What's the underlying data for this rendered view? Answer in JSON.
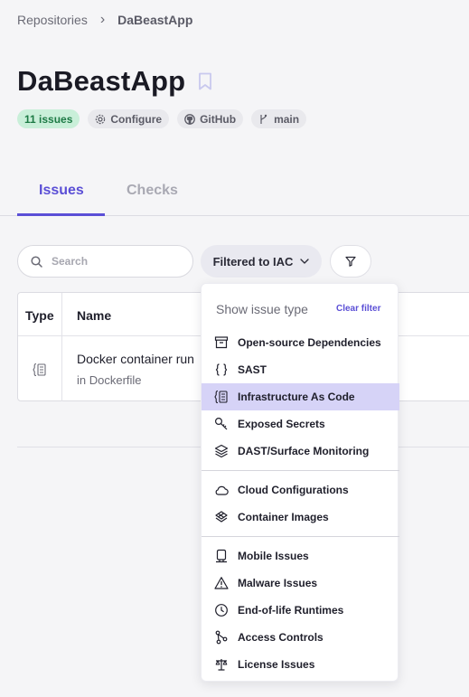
{
  "breadcrumb": {
    "root": "Repositories",
    "current": "DaBeastApp"
  },
  "page": {
    "title": "DaBeastApp"
  },
  "chips": {
    "issues": "11 issues",
    "configure": "Configure",
    "github": "GitHub",
    "branch": "main"
  },
  "tabs": {
    "issues": "Issues",
    "checks": "Checks"
  },
  "search": {
    "placeholder": "Search",
    "value": ""
  },
  "filter": {
    "label": "Filtered to IAC"
  },
  "table": {
    "headers": {
      "type": "Type",
      "name": "Name"
    },
    "rows": [
      {
        "name": "Docker container run",
        "location": "in Dockerfile"
      }
    ]
  },
  "dropdown": {
    "heading": "Show issue type",
    "clear": "Clear filter",
    "items": [
      {
        "label": "Open-source Dependencies",
        "icon": "package-icon"
      },
      {
        "label": "SAST",
        "icon": "braces-icon"
      },
      {
        "label": "Infrastructure As Code",
        "icon": "iac-icon",
        "selected": true
      },
      {
        "label": "Exposed Secrets",
        "icon": "key-icon"
      },
      {
        "label": "DAST/Surface Monitoring",
        "icon": "layers-icon"
      },
      {
        "label": "Cloud Configurations",
        "icon": "cloud-icon"
      },
      {
        "label": "Container Images",
        "icon": "container-icon"
      },
      {
        "label": "Mobile Issues",
        "icon": "mobile-icon"
      },
      {
        "label": "Malware Issues",
        "icon": "warning-icon"
      },
      {
        "label": "End-of-life Runtimes",
        "icon": "clock-icon"
      },
      {
        "label": "Access Controls",
        "icon": "branch-nodes-icon"
      },
      {
        "label": "License Issues",
        "icon": "scale-icon"
      }
    ]
  },
  "colors": {
    "accent": "#5b4fd6",
    "selected_bg": "#d6d3f7",
    "issues_chip_bg": "#c9efd9",
    "issues_chip_text": "#1d7a45"
  }
}
